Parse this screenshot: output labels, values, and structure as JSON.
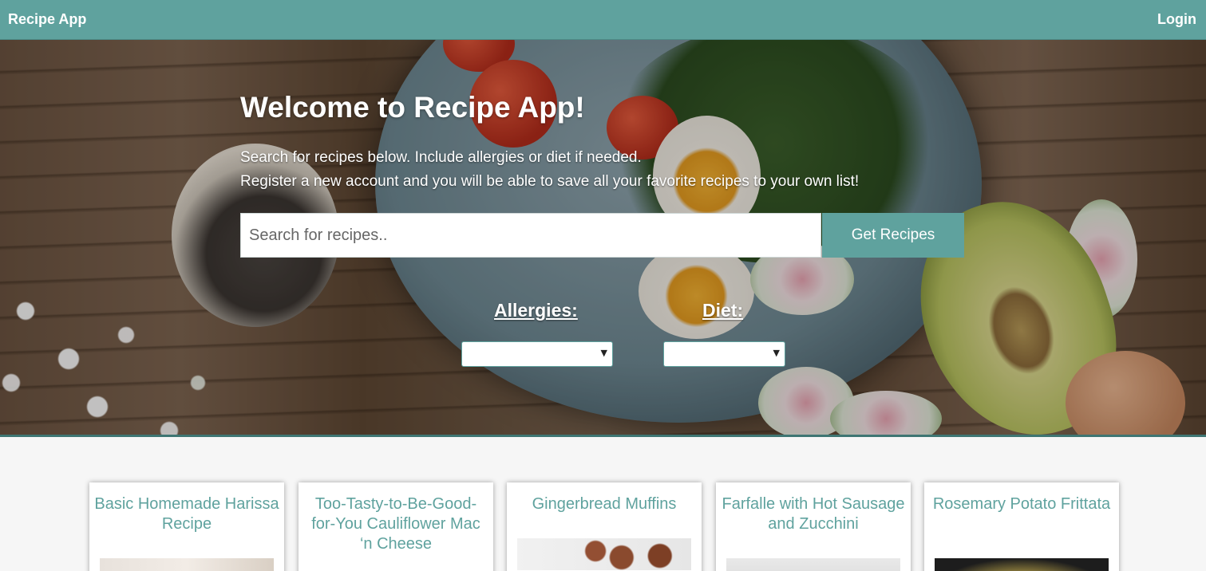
{
  "navbar": {
    "brand": "Recipe App",
    "login": "Login"
  },
  "hero": {
    "title": "Welcome to Recipe App!",
    "line1": "Search for recipes below. Include allergies or diet if needed.",
    "line2": "Register a new account and you will be able to save all your favorite recipes to your own list!",
    "search_placeholder": "Search for recipes..",
    "search_button": "Get Recipes",
    "allergies_label": "Allergies:",
    "diet_label": "Diet:",
    "allergies_value": "",
    "diet_value": ""
  },
  "cards": [
    {
      "title": "Basic Homemade Harissa Recipe"
    },
    {
      "title": "Too-Tasty-to-Be-Good-for-You Cauliflower Mac ‘n Cheese"
    },
    {
      "title": "Gingerbread Muffins"
    },
    {
      "title": "Farfalle with Hot Sausage and Zucchini"
    },
    {
      "title": "Rosemary Potato Frittata"
    }
  ],
  "colors": {
    "accent": "#5fa29e"
  }
}
